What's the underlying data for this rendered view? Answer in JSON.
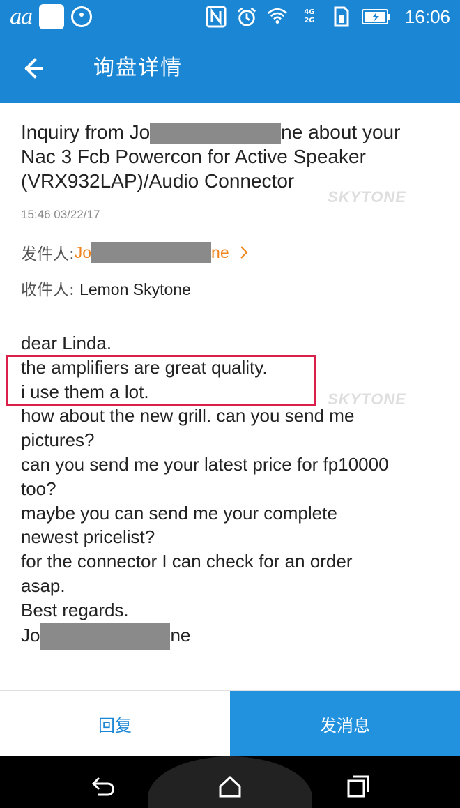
{
  "status_bar": {
    "left_glyphs": "aa",
    "time": "16:06",
    "icons": [
      "nfc-icon",
      "alarm-icon",
      "wifi-icon",
      "signal-4g-icon",
      "signal-2g-icon",
      "sim-icon",
      "battery-charging-icon"
    ],
    "signal_4g": "4G",
    "signal_2g": "2G"
  },
  "app_bar": {
    "title": "询盘详情",
    "back_icon": "back-arrow-icon"
  },
  "inquiry": {
    "subject_line1_prefix": "Inquiry from Jo",
    "subject_line1_suffix": "ne about your",
    "subject_line2": "Nac 3 Fcb Powercon for Active Speaker",
    "subject_line3": "(VRX932LAP)/Audio Connector",
    "timestamp": "15:46 03/22/17",
    "sender_label": "发件人: ",
    "sender_prefix": "Jo",
    "sender_suffix": "ne",
    "recipient_label": "收件人: ",
    "recipient_name": "Lemon Skytone"
  },
  "message_lines": [
    "dear Linda.",
    "the amplifiers are great quality.",
    "i use them a lot.",
    "how about the new grill. can you send me",
    "pictures?",
    "can you send me your latest price for fp10000",
    "too?",
    "maybe you can send me your complete",
    "newest pricelist?",
    "for the connector I can check for an order",
    "asap.",
    "Best regards."
  ],
  "signature_prefix": "Jo",
  "signature_suffix": "ne",
  "watermark_text": "SKYTONE",
  "actions": {
    "reply": "回复",
    "send_message": "发消息"
  },
  "colors": {
    "primary": "#1a86d4",
    "sender_accent": "#f0841c",
    "highlight": "#d8204a"
  }
}
